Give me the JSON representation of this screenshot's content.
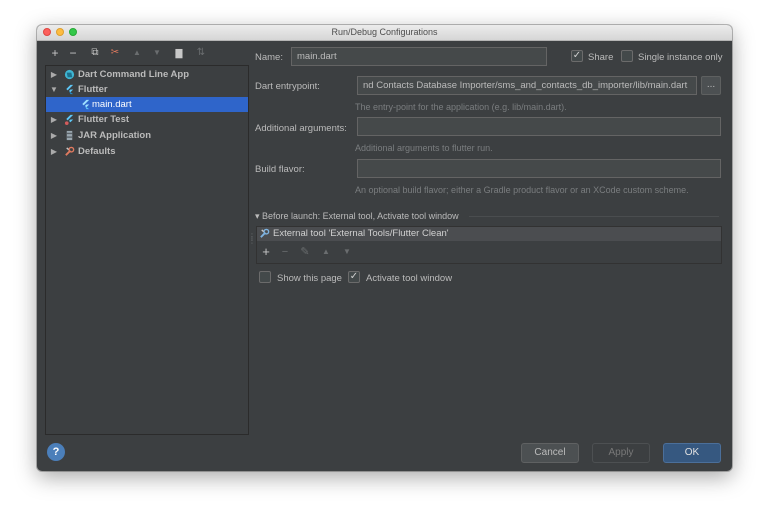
{
  "window": {
    "title": "Run/Debug Configurations"
  },
  "toolbar": {
    "add": "+",
    "remove": "−",
    "copy": "⧉",
    "edit_defaults": "✂",
    "move_up": "▲",
    "move_down": "▼",
    "folder": "▇",
    "sort": "⇅"
  },
  "tree": {
    "items": [
      {
        "label": "Dart Command Line App",
        "icon": "dart-icon"
      },
      {
        "label": "Flutter",
        "icon": "flutter-icon"
      },
      {
        "label": "main.dart",
        "icon": "flutter-run-icon"
      },
      {
        "label": "Flutter Test",
        "icon": "flutter-test-icon"
      },
      {
        "label": "JAR Application",
        "icon": "jar-icon"
      },
      {
        "label": "Defaults",
        "icon": "wrench-icon"
      }
    ]
  },
  "form": {
    "name_label": "Name:",
    "name_value": "main.dart",
    "share_label": "Share",
    "share_checked": true,
    "single_instance_label": "Single instance only",
    "single_instance_checked": false,
    "entrypoint_label": "Dart entrypoint:",
    "entrypoint_value": "nd Contacts Database Importer/sms_and_contacts_db_importer/lib/main.dart",
    "browse_label": "...",
    "entrypoint_hint": "The entry-point for the application (e.g. lib/main.dart).",
    "args_label": "Additional arguments:",
    "args_value": "",
    "args_hint": "Additional arguments to flutter run.",
    "flavor_label": "Build flavor:",
    "flavor_value": "",
    "flavor_hint": "An optional build flavor; either a Gradle product flavor or an XCode custom scheme."
  },
  "before_launch": {
    "header": "Before launch: External tool, Activate tool window",
    "task": "External tool 'External Tools/Flutter Clean'",
    "tools": {
      "add": "+",
      "remove": "−",
      "edit": "✎",
      "up": "▲",
      "down": "▼"
    },
    "show_page_label": "Show this page",
    "show_page_checked": false,
    "activate_label": "Activate tool window",
    "activate_checked": true
  },
  "footer": {
    "help": "?",
    "cancel": "Cancel",
    "apply": "Apply",
    "ok": "OK"
  },
  "colors": {
    "panel": "#3c3f41",
    "selection": "#2f65ca",
    "ok": "#365880"
  }
}
